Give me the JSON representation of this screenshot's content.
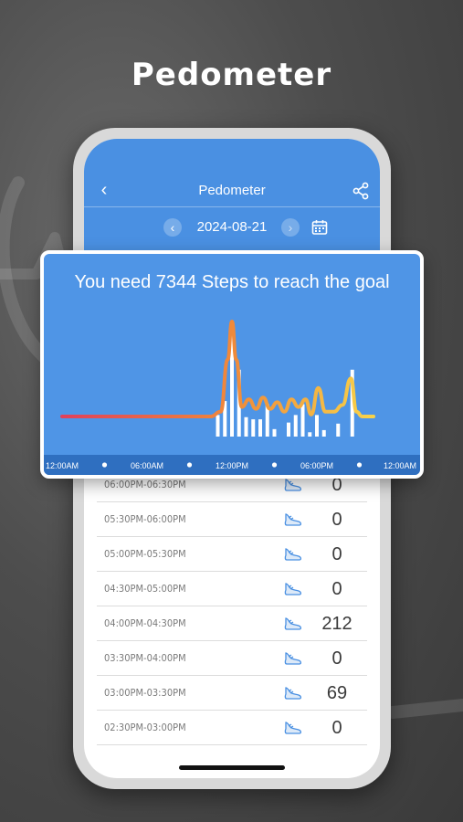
{
  "promo": {
    "title": "Pedometer"
  },
  "app": {
    "title": "Pedometer",
    "back_icon": "chevron-left-icon",
    "share_icon": "share-icon",
    "date": "2024-08-21",
    "prev_glyph": "‹",
    "next_glyph": "›",
    "back_glyph": "‹",
    "calendar_icon": "calendar-icon"
  },
  "chart_data": {
    "type": "line",
    "title": "You need 7344 Steps to reach the goal",
    "x_tick_labels": [
      "12:00AM",
      "06:00AM",
      "12:00PM",
      "06:00PM",
      "12:00AM"
    ],
    "x_range_hours": [
      0,
      24
    ],
    "bars": [
      {
        "hour": 11.0,
        "value": 200
      },
      {
        "hour": 11.5,
        "value": 330
      },
      {
        "hour": 12.0,
        "value": 1050
      },
      {
        "hour": 12.5,
        "value": 620
      },
      {
        "hour": 13.0,
        "value": 180
      },
      {
        "hour": 13.5,
        "value": 160
      },
      {
        "hour": 14.0,
        "value": 160
      },
      {
        "hour": 14.5,
        "value": 300
      },
      {
        "hour": 15.0,
        "value": 69
      },
      {
        "hour": 16.0,
        "value": 130
      },
      {
        "hour": 16.5,
        "value": 200
      },
      {
        "hour": 17.0,
        "value": 300
      },
      {
        "hour": 17.5,
        "value": 40
      },
      {
        "hour": 18.0,
        "value": 200
      },
      {
        "hour": 18.5,
        "value": 60
      },
      {
        "hour": 19.5,
        "value": 120
      },
      {
        "hour": 20.5,
        "value": 620
      }
    ],
    "bar_max": 1050,
    "line": [
      [
        0,
        0
      ],
      [
        10.5,
        0
      ],
      [
        11.2,
        0.05
      ],
      [
        11.7,
        0.6
      ],
      [
        12.0,
        1.0
      ],
      [
        12.3,
        0.6
      ],
      [
        12.7,
        0.1
      ],
      [
        13.2,
        0.18
      ],
      [
        13.7,
        0.08
      ],
      [
        14.2,
        0.2
      ],
      [
        14.7,
        0.08
      ],
      [
        15.2,
        0.15
      ],
      [
        15.7,
        0.05
      ],
      [
        16.2,
        0.18
      ],
      [
        16.7,
        0.1
      ],
      [
        17.2,
        0.18
      ],
      [
        17.6,
        0.02
      ],
      [
        18.1,
        0.3
      ],
      [
        18.6,
        0.05
      ],
      [
        19.2,
        0.05
      ],
      [
        19.8,
        0.12
      ],
      [
        20.4,
        0.4
      ],
      [
        20.8,
        0.05
      ],
      [
        21.2,
        0.0
      ],
      [
        22.0,
        0.0
      ]
    ],
    "colors": {
      "line_start": "#e0405a",
      "line_mid": "#f08a3a",
      "line_end": "#f7d34a",
      "bars": "#ffffff",
      "background": "#4f95e6"
    },
    "grid": false
  },
  "rows": [
    {
      "time": "06:00PM-06:30PM",
      "steps": "0"
    },
    {
      "time": "05:30PM-06:00PM",
      "steps": "0"
    },
    {
      "time": "05:00PM-05:30PM",
      "steps": "0"
    },
    {
      "time": "04:30PM-05:00PM",
      "steps": "0"
    },
    {
      "time": "04:00PM-04:30PM",
      "steps": "212"
    },
    {
      "time": "03:30PM-04:00PM",
      "steps": "0"
    },
    {
      "time": "03:00PM-03:30PM",
      "steps": "69"
    },
    {
      "time": "02:30PM-03:00PM",
      "steps": "0"
    }
  ],
  "row_icon": "shoe-icon",
  "colors": {
    "accent": "#4a90e2"
  }
}
